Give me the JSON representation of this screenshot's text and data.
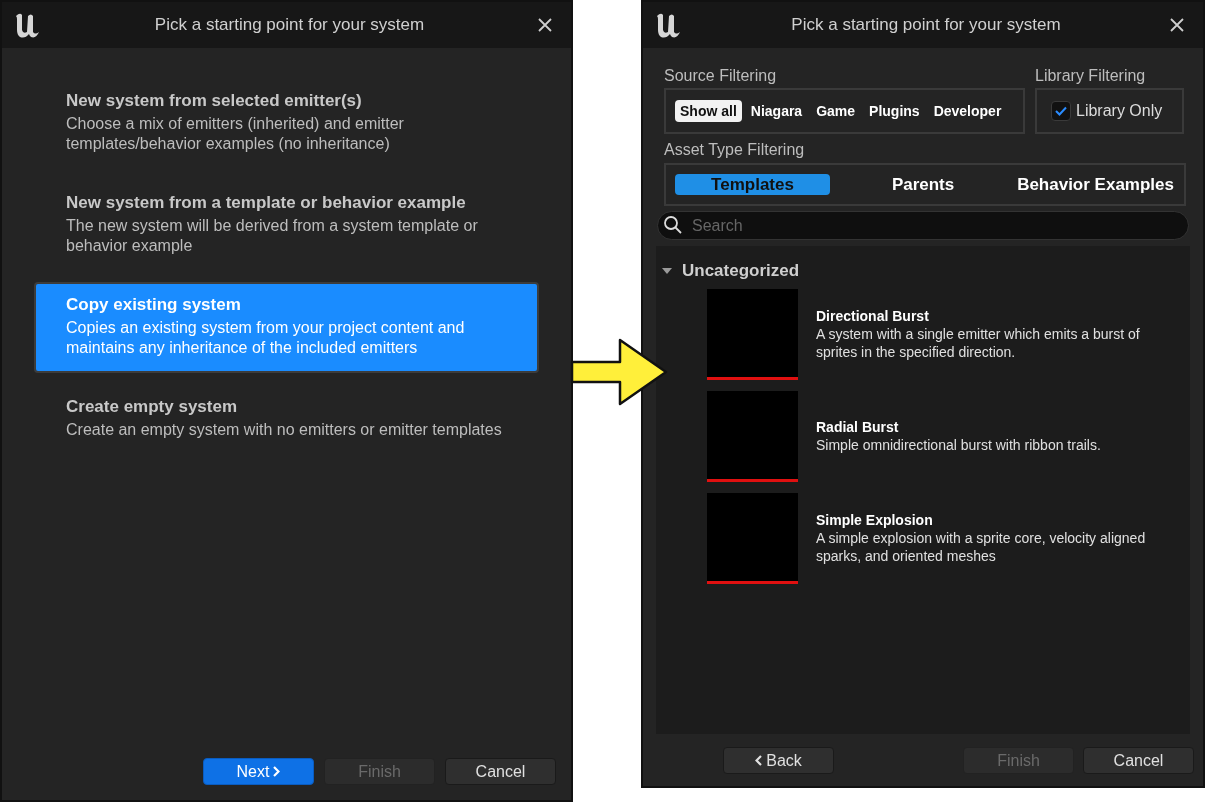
{
  "left_window": {
    "title": "Pick a starting point for your system",
    "options": [
      {
        "title": "New system from selected emitter(s)",
        "description": "Choose a mix of emitters (inherited) and emitter templates/behavior examples (no inheritance)",
        "selected": false
      },
      {
        "title": "New system from a template or behavior example",
        "description": "The new system will be derived from a system template or behavior example",
        "selected": false
      },
      {
        "title": "Copy existing system",
        "description": "Copies an existing system from your project content and maintains any inheritance of the included emitters",
        "selected": true
      },
      {
        "title": "Create empty system",
        "description": "Create an empty system with no emitters or emitter templates",
        "selected": false
      }
    ],
    "buttons": [
      {
        "label": "Next",
        "kind": "next",
        "disabled": false
      },
      {
        "label": "Finish",
        "kind": "plain",
        "disabled": true
      },
      {
        "label": "Cancel",
        "kind": "plain",
        "disabled": false
      }
    ]
  },
  "right_window": {
    "title": "Pick a starting point for your system",
    "source_filtering": {
      "label": "Source Filtering",
      "options": [
        {
          "label": "Show all",
          "selected": true
        },
        {
          "label": "Niagara",
          "selected": false
        },
        {
          "label": "Game",
          "selected": false
        },
        {
          "label": "Plugins",
          "selected": false
        },
        {
          "label": "Developer",
          "selected": false
        }
      ]
    },
    "library_filtering": {
      "label": "Library Filtering",
      "checkbox": {
        "label": "Library Only",
        "checked": true
      }
    },
    "asset_type_filtering": {
      "label": "Asset Type Filtering",
      "tabs": [
        {
          "label": "Templates",
          "selected": true
        },
        {
          "label": "Parents",
          "selected": false
        },
        {
          "label": "Behavior Examples",
          "selected": false
        }
      ]
    },
    "search": {
      "placeholder": "Search"
    },
    "category": {
      "label": "Uncategorized",
      "expanded": true,
      "items": [
        {
          "title": "Directional Burst",
          "description": "A system with a single emitter which emits a burst of sprites in the specified direction.",
          "color": "#e01010"
        },
        {
          "title": "Radial Burst",
          "description": "Simple omnidirectional burst with ribbon trails.",
          "color": "#e01010"
        },
        {
          "title": "Simple Explosion",
          "description": "A simple explosion with a sprite core, velocity aligned sparks, and oriented meshes",
          "color": "#e01010"
        }
      ]
    },
    "buttons": [
      {
        "label": "Back",
        "kind": "back",
        "disabled": false
      },
      {
        "label": "Finish",
        "kind": "plain",
        "disabled": true
      },
      {
        "label": "Cancel",
        "kind": "plain",
        "disabled": false
      }
    ]
  }
}
